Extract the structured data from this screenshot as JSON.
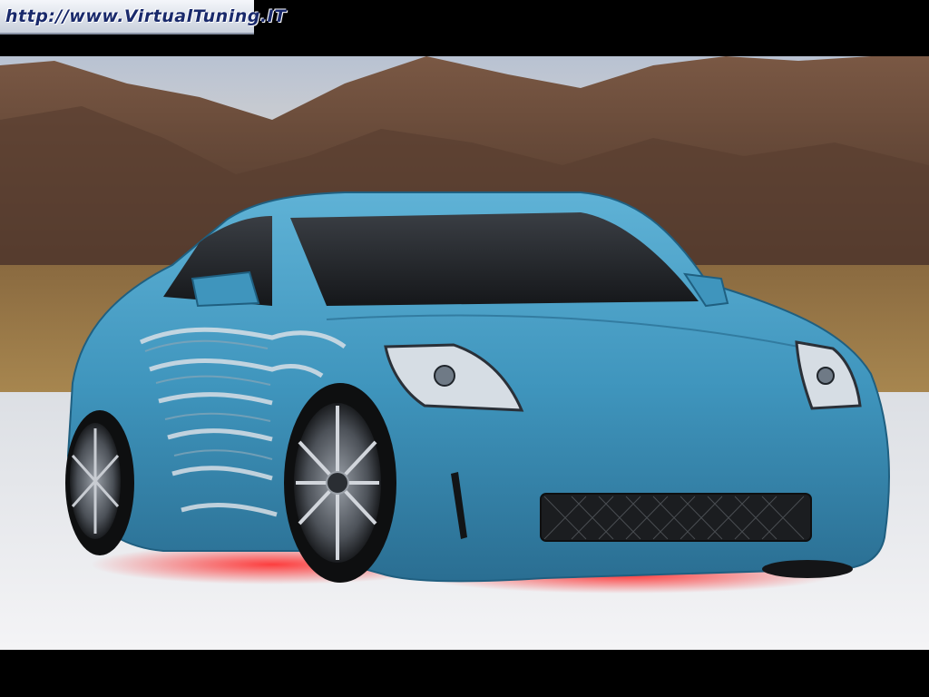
{
  "watermark": {
    "text": "http://www.VirtualTuning.IT"
  },
  "colors": {
    "car_body": "#3f95bd",
    "car_shadow": "#1f5f80",
    "underglow": "#d6202a",
    "sky": "#c9cfd9",
    "mountains": "#6b4a38",
    "salt_flat": "#e8eaee"
  },
  "icons": [
    "car-image",
    "flame-decal",
    "mountain-backdrop"
  ]
}
